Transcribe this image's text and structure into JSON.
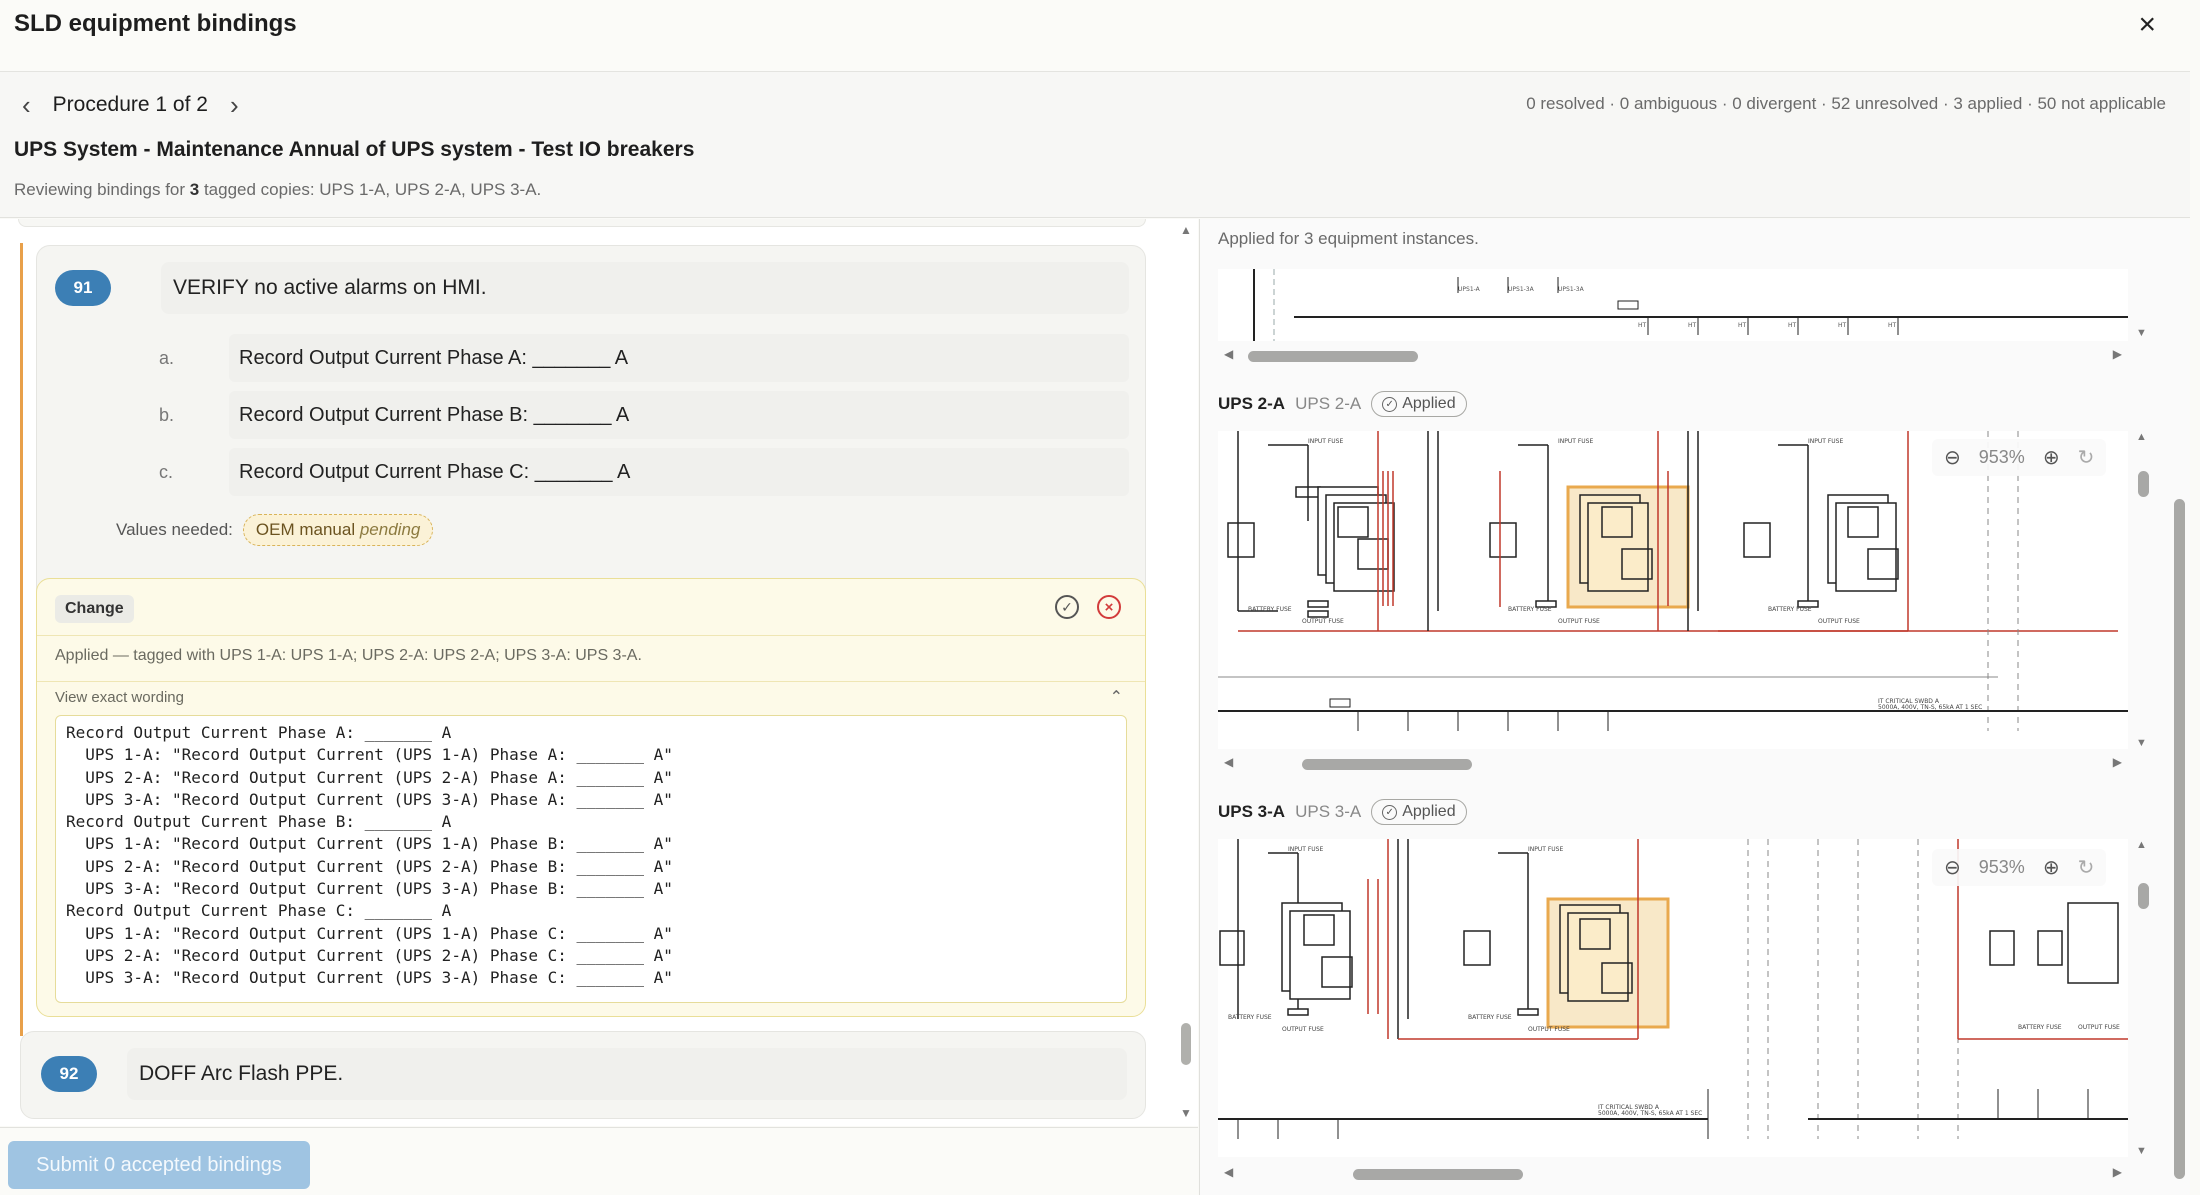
{
  "dialog": {
    "title": "SLD equipment bindings",
    "close": "×"
  },
  "procedure": {
    "prev": "‹",
    "next": "›",
    "label": "Procedure 1 of 2",
    "stats": "0 resolved · 0 ambiguous · 0 divergent · 52 unresolved · 3 applied · 50 not applicable",
    "title": "UPS System - Maintenance Annual of UPS system - Test IO breakers",
    "review_prefix": "Reviewing bindings for ",
    "review_count": "3",
    "review_suffix": " tagged copies: UPS 1-A, UPS 2-A, UPS 3-A."
  },
  "step91": {
    "number": "91",
    "text": "VERIFY no active alarms on HMI.",
    "substeps": [
      {
        "letter": "a.",
        "text": "Record Output Current Phase A: _______ A"
      },
      {
        "letter": "b.",
        "text": "Record Output Current Phase B: _______ A"
      },
      {
        "letter": "c.",
        "text": "Record Output Current Phase C: _______ A"
      }
    ],
    "values_label": "Values needed:",
    "values_pill": "OEM manual",
    "values_status": "pending"
  },
  "change": {
    "chip": "Change",
    "accept_icon": "✓",
    "reject_icon": "×",
    "applied": "Applied — tagged with UPS 1-A: UPS 1-A; UPS 2-A: UPS 2-A; UPS 3-A: UPS 3-A.",
    "view_exact": "View exact wording",
    "caret": "⌃",
    "wording": "Record Output Current Phase A: _______ A\n  UPS 1-A: \"Record Output Current (UPS 1-A) Phase A: _______ A\"\n  UPS 2-A: \"Record Output Current (UPS 2-A) Phase A: _______ A\"\n  UPS 3-A: \"Record Output Current (UPS 3-A) Phase A: _______ A\"\nRecord Output Current Phase B: _______ A\n  UPS 1-A: \"Record Output Current (UPS 1-A) Phase B: _______ A\"\n  UPS 2-A: \"Record Output Current (UPS 2-A) Phase B: _______ A\"\n  UPS 3-A: \"Record Output Current (UPS 3-A) Phase B: _______ A\"\nRecord Output Current Phase C: _______ A\n  UPS 1-A: \"Record Output Current (UPS 1-A) Phase C: _______ A\"\n  UPS 2-A: \"Record Output Current (UPS 2-A) Phase C: _______ A\"\n  UPS 3-A: \"Record Output Current (UPS 3-A) Phase C: _______ A\""
  },
  "step92": {
    "number": "92",
    "text": "DOFF Arc Flash PPE."
  },
  "footer": {
    "submit": "Submit 0 accepted bindings"
  },
  "right": {
    "applied_note": "Applied for 3 equipment instances.",
    "panels": [
      {
        "name": "UPS 2-A",
        "alias": "UPS 2-A",
        "status": "Applied",
        "zoom": "953%"
      },
      {
        "name": "UPS 3-A",
        "alias": "UPS 3-A",
        "status": "Applied",
        "zoom": "953%"
      }
    ]
  },
  "diagram_labels": {
    "input_fuse": "INPUT FUSE",
    "battery_fuse": "BATTERY FUSE",
    "output_fuse": "OUTPUT FUSE",
    "critical_swbd": "IT CRITICAL SWBD A",
    "critical_rating": "5000A, 400V, TN-S, 65kA AT 1 SEC"
  },
  "colors": {
    "accent": "#3c7fb5",
    "warning_bar": "#e8a04a",
    "highlight": "#e9a94e",
    "reject": "#d23b3b"
  }
}
